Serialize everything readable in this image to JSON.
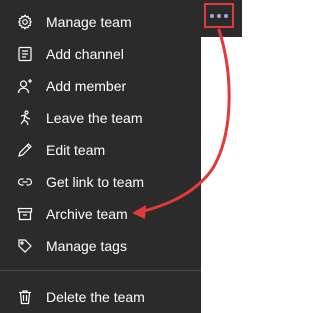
{
  "menu": {
    "items": [
      {
        "label": "Manage team",
        "icon": "gear-icon"
      },
      {
        "label": "Add channel",
        "icon": "channel-icon"
      },
      {
        "label": "Add member",
        "icon": "add-person-icon"
      },
      {
        "label": "Leave the team",
        "icon": "leave-icon"
      },
      {
        "label": "Edit team",
        "icon": "pencil-icon"
      },
      {
        "label": "Get link to team",
        "icon": "link-icon"
      },
      {
        "label": "Archive team",
        "icon": "archive-icon"
      },
      {
        "label": "Manage tags",
        "icon": "tag-icon"
      }
    ],
    "delete_label": "Delete the team",
    "delete_icon": "trash-icon"
  },
  "more_button": {
    "icon": "ellipsis-icon"
  },
  "colors": {
    "menu_bg": "#2b2b2b",
    "text": "#ffffff",
    "highlight": "#e23a3a",
    "ellipsis": "#a6a7dc"
  }
}
